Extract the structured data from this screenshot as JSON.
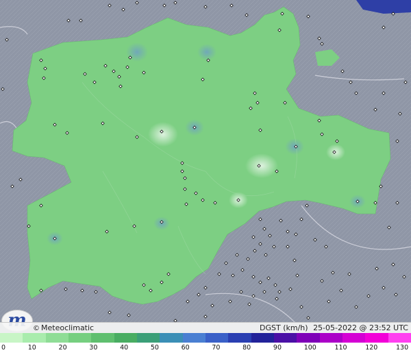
{
  "map": {
    "region": "Castilla y León",
    "field_color": "#7dcf83",
    "background_relief_color": "#8f96a6",
    "field_note": "Wind gust field mostly 20–40 km/h over the whole region, light spots near 40 km/h"
  },
  "brand": {
    "symbol": "©",
    "name": "Meteoclimatic",
    "logo_letter": "m"
  },
  "info": {
    "parameter": "DGST (km/h)",
    "datetime": "25-05-2022 @ 23:52 UTC"
  },
  "scale": {
    "colors": [
      "#c8f5c6",
      "#a9ecad",
      "#8fdd96",
      "#76cf80",
      "#5fbf6f",
      "#49ad62",
      "#3b9f78",
      "#3b8fb6",
      "#4a7fd2",
      "#3a60c8",
      "#2a3fb2",
      "#22229a",
      "#4a10a6",
      "#7e00b8",
      "#ab00c8",
      "#d400d4",
      "#f200d8",
      "#ff40f0"
    ],
    "labels": [
      "0",
      "10",
      "20",
      "30",
      "40",
      "50",
      "60",
      "70",
      "80",
      "90",
      "100",
      "110",
      "120",
      "130"
    ]
  },
  "stations": {
    "icon": "station-diamond-icon"
  }
}
